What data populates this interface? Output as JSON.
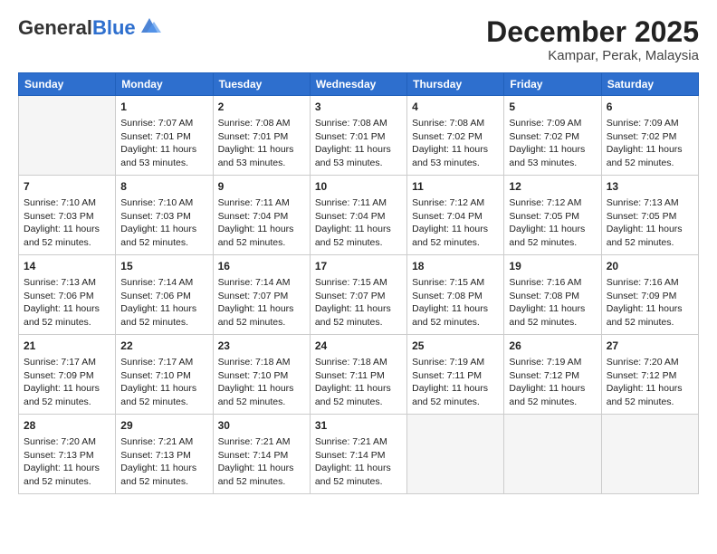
{
  "header": {
    "logo_general": "General",
    "logo_blue": "Blue",
    "month_title": "December 2025",
    "location": "Kampar, Perak, Malaysia"
  },
  "days_of_week": [
    "Sunday",
    "Monday",
    "Tuesday",
    "Wednesday",
    "Thursday",
    "Friday",
    "Saturday"
  ],
  "weeks": [
    [
      {
        "day": "",
        "sunrise": "",
        "sunset": "",
        "daylight": "",
        "empty": true
      },
      {
        "day": "1",
        "sunrise": "Sunrise: 7:07 AM",
        "sunset": "Sunset: 7:01 PM",
        "daylight": "Daylight: 11 hours and 53 minutes."
      },
      {
        "day": "2",
        "sunrise": "Sunrise: 7:08 AM",
        "sunset": "Sunset: 7:01 PM",
        "daylight": "Daylight: 11 hours and 53 minutes."
      },
      {
        "day": "3",
        "sunrise": "Sunrise: 7:08 AM",
        "sunset": "Sunset: 7:01 PM",
        "daylight": "Daylight: 11 hours and 53 minutes."
      },
      {
        "day": "4",
        "sunrise": "Sunrise: 7:08 AM",
        "sunset": "Sunset: 7:02 PM",
        "daylight": "Daylight: 11 hours and 53 minutes."
      },
      {
        "day": "5",
        "sunrise": "Sunrise: 7:09 AM",
        "sunset": "Sunset: 7:02 PM",
        "daylight": "Daylight: 11 hours and 53 minutes."
      },
      {
        "day": "6",
        "sunrise": "Sunrise: 7:09 AM",
        "sunset": "Sunset: 7:02 PM",
        "daylight": "Daylight: 11 hours and 52 minutes."
      }
    ],
    [
      {
        "day": "7",
        "sunrise": "Sunrise: 7:10 AM",
        "sunset": "Sunset: 7:03 PM",
        "daylight": "Daylight: 11 hours and 52 minutes."
      },
      {
        "day": "8",
        "sunrise": "Sunrise: 7:10 AM",
        "sunset": "Sunset: 7:03 PM",
        "daylight": "Daylight: 11 hours and 52 minutes."
      },
      {
        "day": "9",
        "sunrise": "Sunrise: 7:11 AM",
        "sunset": "Sunset: 7:04 PM",
        "daylight": "Daylight: 11 hours and 52 minutes."
      },
      {
        "day": "10",
        "sunrise": "Sunrise: 7:11 AM",
        "sunset": "Sunset: 7:04 PM",
        "daylight": "Daylight: 11 hours and 52 minutes."
      },
      {
        "day": "11",
        "sunrise": "Sunrise: 7:12 AM",
        "sunset": "Sunset: 7:04 PM",
        "daylight": "Daylight: 11 hours and 52 minutes."
      },
      {
        "day": "12",
        "sunrise": "Sunrise: 7:12 AM",
        "sunset": "Sunset: 7:05 PM",
        "daylight": "Daylight: 11 hours and 52 minutes."
      },
      {
        "day": "13",
        "sunrise": "Sunrise: 7:13 AM",
        "sunset": "Sunset: 7:05 PM",
        "daylight": "Daylight: 11 hours and 52 minutes."
      }
    ],
    [
      {
        "day": "14",
        "sunrise": "Sunrise: 7:13 AM",
        "sunset": "Sunset: 7:06 PM",
        "daylight": "Daylight: 11 hours and 52 minutes."
      },
      {
        "day": "15",
        "sunrise": "Sunrise: 7:14 AM",
        "sunset": "Sunset: 7:06 PM",
        "daylight": "Daylight: 11 hours and 52 minutes."
      },
      {
        "day": "16",
        "sunrise": "Sunrise: 7:14 AM",
        "sunset": "Sunset: 7:07 PM",
        "daylight": "Daylight: 11 hours and 52 minutes."
      },
      {
        "day": "17",
        "sunrise": "Sunrise: 7:15 AM",
        "sunset": "Sunset: 7:07 PM",
        "daylight": "Daylight: 11 hours and 52 minutes."
      },
      {
        "day": "18",
        "sunrise": "Sunrise: 7:15 AM",
        "sunset": "Sunset: 7:08 PM",
        "daylight": "Daylight: 11 hours and 52 minutes."
      },
      {
        "day": "19",
        "sunrise": "Sunrise: 7:16 AM",
        "sunset": "Sunset: 7:08 PM",
        "daylight": "Daylight: 11 hours and 52 minutes."
      },
      {
        "day": "20",
        "sunrise": "Sunrise: 7:16 AM",
        "sunset": "Sunset: 7:09 PM",
        "daylight": "Daylight: 11 hours and 52 minutes."
      }
    ],
    [
      {
        "day": "21",
        "sunrise": "Sunrise: 7:17 AM",
        "sunset": "Sunset: 7:09 PM",
        "daylight": "Daylight: 11 hours and 52 minutes."
      },
      {
        "day": "22",
        "sunrise": "Sunrise: 7:17 AM",
        "sunset": "Sunset: 7:10 PM",
        "daylight": "Daylight: 11 hours and 52 minutes."
      },
      {
        "day": "23",
        "sunrise": "Sunrise: 7:18 AM",
        "sunset": "Sunset: 7:10 PM",
        "daylight": "Daylight: 11 hours and 52 minutes."
      },
      {
        "day": "24",
        "sunrise": "Sunrise: 7:18 AM",
        "sunset": "Sunset: 7:11 PM",
        "daylight": "Daylight: 11 hours and 52 minutes."
      },
      {
        "day": "25",
        "sunrise": "Sunrise: 7:19 AM",
        "sunset": "Sunset: 7:11 PM",
        "daylight": "Daylight: 11 hours and 52 minutes."
      },
      {
        "day": "26",
        "sunrise": "Sunrise: 7:19 AM",
        "sunset": "Sunset: 7:12 PM",
        "daylight": "Daylight: 11 hours and 52 minutes."
      },
      {
        "day": "27",
        "sunrise": "Sunrise: 7:20 AM",
        "sunset": "Sunset: 7:12 PM",
        "daylight": "Daylight: 11 hours and 52 minutes."
      }
    ],
    [
      {
        "day": "28",
        "sunrise": "Sunrise: 7:20 AM",
        "sunset": "Sunset: 7:13 PM",
        "daylight": "Daylight: 11 hours and 52 minutes."
      },
      {
        "day": "29",
        "sunrise": "Sunrise: 7:21 AM",
        "sunset": "Sunset: 7:13 PM",
        "daylight": "Daylight: 11 hours and 52 minutes."
      },
      {
        "day": "30",
        "sunrise": "Sunrise: 7:21 AM",
        "sunset": "Sunset: 7:14 PM",
        "daylight": "Daylight: 11 hours and 52 minutes."
      },
      {
        "day": "31",
        "sunrise": "Sunrise: 7:21 AM",
        "sunset": "Sunset: 7:14 PM",
        "daylight": "Daylight: 11 hours and 52 minutes."
      },
      {
        "day": "",
        "sunrise": "",
        "sunset": "",
        "daylight": "",
        "empty": true
      },
      {
        "day": "",
        "sunrise": "",
        "sunset": "",
        "daylight": "",
        "empty": true
      },
      {
        "day": "",
        "sunrise": "",
        "sunset": "",
        "daylight": "",
        "empty": true
      }
    ]
  ]
}
